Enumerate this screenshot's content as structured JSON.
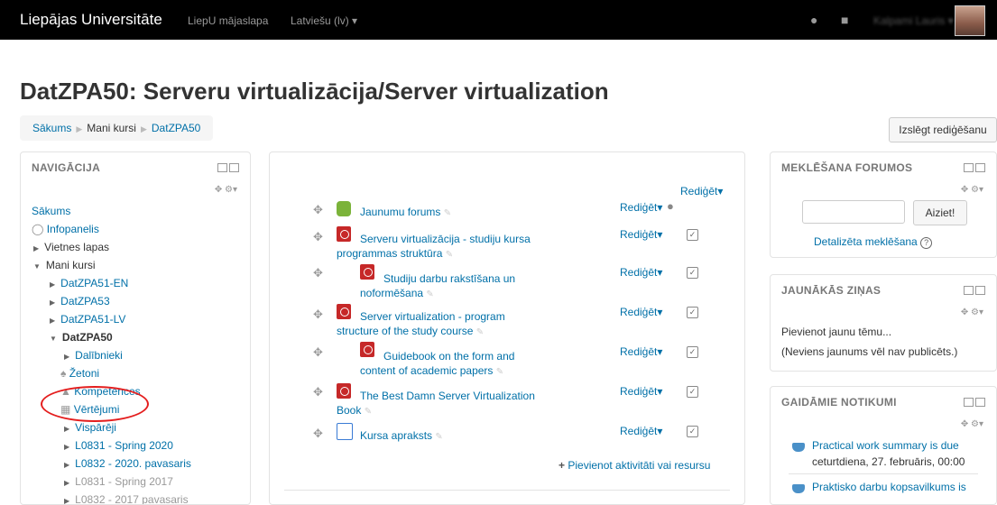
{
  "topbar": {
    "brand": "Liepājas Universitāte",
    "links": [
      "LiepU mājaslapa",
      "Latviešu (lv) ▾"
    ],
    "username": "Kalpami Lauris ▾"
  },
  "page_title": "DatZPA50: Serveru virtualizācija/Server virtualization",
  "breadcrumb": [
    "Sākums",
    "Mani kursi",
    "DatZPA50"
  ],
  "edit_button": "Izslēgt rediģēšanu",
  "navigation": {
    "title": "NAVIGĀCIJA",
    "items": [
      {
        "label": "Sākums"
      },
      {
        "label": "Infopanelis"
      },
      {
        "label": "Vietnes lapas"
      },
      {
        "label": "Mani kursi"
      },
      {
        "label": "DatZPA51-EN"
      },
      {
        "label": "DatZPA53"
      },
      {
        "label": "DatZPA51-LV"
      },
      {
        "label": "DatZPA50"
      },
      {
        "label": "Dalībnieki"
      },
      {
        "label": "Žetoni"
      },
      {
        "label": "Kompetences"
      },
      {
        "label": "Vērtējumi"
      },
      {
        "label": "Vispārēji"
      },
      {
        "label": "L0831 - Spring 2020"
      },
      {
        "label": "L0832 - 2020. pavasaris"
      },
      {
        "label": "L0831 - Spring 2017"
      },
      {
        "label": "L0832 - 2017 pavasaris"
      }
    ]
  },
  "main": {
    "section_edit": "Rediģēt▾",
    "resources": [
      {
        "lines": [
          "Jaunumu forums"
        ],
        "edit": "Rediģēt▾",
        "icon": "forum-icon"
      },
      {
        "lines": [
          "Serveru virtualizācija - studiju kursa",
          "programmas struktūra"
        ],
        "edit": "Rediģēt▾",
        "icon": "pdf-icon"
      },
      {
        "lines": [
          "Studiju darbu rakstīšana un",
          "noformēšana"
        ],
        "edit": "Rediģēt▾",
        "icon": "pdf-icon"
      },
      {
        "lines": [
          "Server virtualization - program",
          "structure of the study course"
        ],
        "edit": "Rediģēt▾",
        "icon": "pdf-icon"
      },
      {
        "lines": [
          "Guidebook on the form and",
          "content of academic papers"
        ],
        "edit": "Rediģēt▾",
        "icon": "pdf-icon"
      },
      {
        "lines": [
          "The Best Damn Server Virtualization",
          "Book"
        ],
        "edit": "Rediģēt▾",
        "icon": "pdf-icon"
      },
      {
        "lines": [
          "Kursa apraksts"
        ],
        "edit": "Rediģēt▾",
        "icon": "page-icon"
      }
    ],
    "add_activity": "Pievienot aktivitāti vai resursu"
  },
  "forum_search": {
    "title": "MEKLĒŠANA FORUMOS",
    "button": "Aiziet!",
    "advanced": "Detalizēta meklēšana"
  },
  "news": {
    "title": "JAUNĀKĀS ZIŅAS",
    "add": "Pievienot jaunu tēmu...",
    "empty": "(Neviens jaunums vēl nav publicēts.)"
  },
  "events": {
    "title": "GAIDĀMIE NOTIKUMI",
    "items": [
      {
        "lines": [
          "Practical work summary is due",
          "ceturtdiena, 27. februāris, 00:00"
        ]
      },
      {
        "lines": [
          "Praktisko darbu kopsavilkums is"
        ]
      }
    ]
  }
}
